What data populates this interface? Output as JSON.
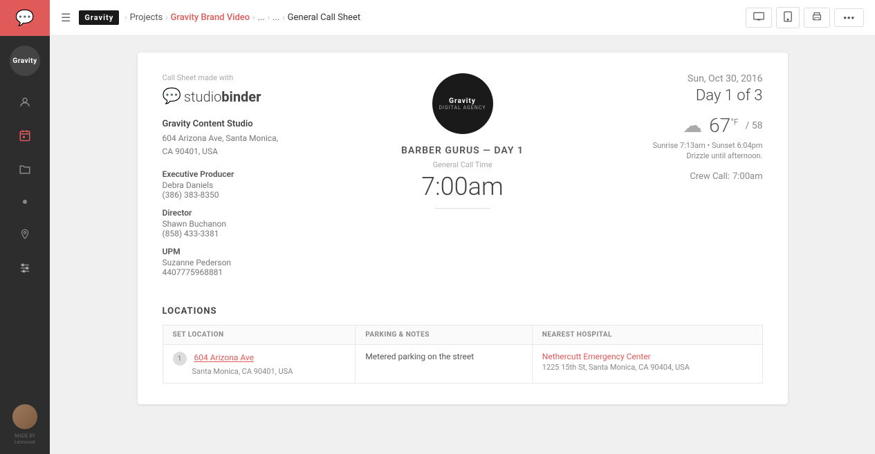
{
  "sidebar": {
    "app_icon": "💬",
    "logo_text": "Gravity",
    "nav_items": [
      {
        "id": "people",
        "icon": "👤",
        "label": "People"
      },
      {
        "id": "calendar",
        "icon": "📅",
        "label": "Calendar"
      },
      {
        "id": "folder",
        "icon": "📁",
        "label": "Projects"
      },
      {
        "id": "dot",
        "icon": "•",
        "label": "Item"
      },
      {
        "id": "location",
        "icon": "📍",
        "label": "Locations"
      },
      {
        "id": "settings",
        "icon": "⚙",
        "label": "Settings"
      }
    ],
    "made_by": "MADE BY\nLennonist"
  },
  "topbar": {
    "hamburger": "☰",
    "logo_text": "Gravity",
    "breadcrumb": {
      "projects_label": "Projects",
      "project_label": "Gravity Brand Video",
      "ellipsis1": "...",
      "ellipsis2": "...",
      "current": "General Call Sheet"
    },
    "view_desktop": "🖥",
    "view_tablet": "📱",
    "view_print": "🖨",
    "more_label": "•••"
  },
  "call_sheet": {
    "made_with_text": "Call Sheet made with",
    "logo_chat_icon": "💬",
    "logo_text_light": "studio",
    "logo_text_bold": "binder",
    "company_name": "Gravity Content Studio",
    "company_address_line1": "604 Arizona Ave, Santa Monica,",
    "company_address_line2": "CA 90401, USA",
    "contacts": [
      {
        "label": "Executive Producer",
        "name": "Debra Daniels",
        "phone": "(386) 383-8350"
      },
      {
        "label": "Director",
        "name": "Shawn Buchanon",
        "phone": "(858) 433-3381"
      },
      {
        "label": "UPM",
        "name": "Suzanne Pederson",
        "phone": "4407775968881"
      }
    ],
    "project_logo_text": "Gravity",
    "project_logo_sub": "DIGITAL AGENCY",
    "project_title": "BARBER GURUS — DAY 1",
    "call_time_label": "General Call Time",
    "call_time": "7:00am",
    "date": "Sun, Oct 30, 2016",
    "day_of": "Day 1 of 3",
    "weather": {
      "icon": "☁",
      "temp_high": "67",
      "temp_unit": "°F",
      "temp_low": "/ 58",
      "sunrise": "Sunrise 7:13am",
      "sunset": "Sunset 6:04pm",
      "description": "Drizzle until afternoon."
    },
    "crew_call_label": "Crew Call:",
    "crew_call_time": "7:00am",
    "locations_title": "LOCATIONS",
    "locations_headers": [
      "SET LOCATION",
      "PARKING & NOTES",
      "NEAREST HOSPITAL"
    ],
    "locations": [
      {
        "num": "1",
        "address_link": "604 Arizona Ave",
        "address_city": "Santa Monica, CA 90401, USA",
        "parking": "Metered parking on the street",
        "hospital_name": "Nethercutt Emergency Center",
        "hospital_addr": "1225 15th St, Santa Monica, CA 90404, USA"
      }
    ]
  }
}
